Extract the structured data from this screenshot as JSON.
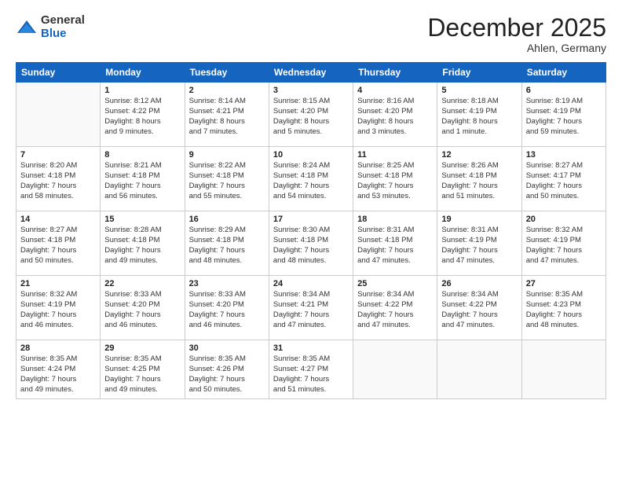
{
  "logo": {
    "general": "General",
    "blue": "Blue"
  },
  "header": {
    "month": "December 2025",
    "location": "Ahlen, Germany"
  },
  "weekdays": [
    "Sunday",
    "Monday",
    "Tuesday",
    "Wednesday",
    "Thursday",
    "Friday",
    "Saturday"
  ],
  "weeks": [
    [
      {
        "day": "",
        "info": ""
      },
      {
        "day": "1",
        "info": "Sunrise: 8:12 AM\nSunset: 4:22 PM\nDaylight: 8 hours\nand 9 minutes."
      },
      {
        "day": "2",
        "info": "Sunrise: 8:14 AM\nSunset: 4:21 PM\nDaylight: 8 hours\nand 7 minutes."
      },
      {
        "day": "3",
        "info": "Sunrise: 8:15 AM\nSunset: 4:20 PM\nDaylight: 8 hours\nand 5 minutes."
      },
      {
        "day": "4",
        "info": "Sunrise: 8:16 AM\nSunset: 4:20 PM\nDaylight: 8 hours\nand 3 minutes."
      },
      {
        "day": "5",
        "info": "Sunrise: 8:18 AM\nSunset: 4:19 PM\nDaylight: 8 hours\nand 1 minute."
      },
      {
        "day": "6",
        "info": "Sunrise: 8:19 AM\nSunset: 4:19 PM\nDaylight: 7 hours\nand 59 minutes."
      }
    ],
    [
      {
        "day": "7",
        "info": "Sunrise: 8:20 AM\nSunset: 4:18 PM\nDaylight: 7 hours\nand 58 minutes."
      },
      {
        "day": "8",
        "info": "Sunrise: 8:21 AM\nSunset: 4:18 PM\nDaylight: 7 hours\nand 56 minutes."
      },
      {
        "day": "9",
        "info": "Sunrise: 8:22 AM\nSunset: 4:18 PM\nDaylight: 7 hours\nand 55 minutes."
      },
      {
        "day": "10",
        "info": "Sunrise: 8:24 AM\nSunset: 4:18 PM\nDaylight: 7 hours\nand 54 minutes."
      },
      {
        "day": "11",
        "info": "Sunrise: 8:25 AM\nSunset: 4:18 PM\nDaylight: 7 hours\nand 53 minutes."
      },
      {
        "day": "12",
        "info": "Sunrise: 8:26 AM\nSunset: 4:18 PM\nDaylight: 7 hours\nand 51 minutes."
      },
      {
        "day": "13",
        "info": "Sunrise: 8:27 AM\nSunset: 4:17 PM\nDaylight: 7 hours\nand 50 minutes."
      }
    ],
    [
      {
        "day": "14",
        "info": "Sunrise: 8:27 AM\nSunset: 4:18 PM\nDaylight: 7 hours\nand 50 minutes."
      },
      {
        "day": "15",
        "info": "Sunrise: 8:28 AM\nSunset: 4:18 PM\nDaylight: 7 hours\nand 49 minutes."
      },
      {
        "day": "16",
        "info": "Sunrise: 8:29 AM\nSunset: 4:18 PM\nDaylight: 7 hours\nand 48 minutes."
      },
      {
        "day": "17",
        "info": "Sunrise: 8:30 AM\nSunset: 4:18 PM\nDaylight: 7 hours\nand 48 minutes."
      },
      {
        "day": "18",
        "info": "Sunrise: 8:31 AM\nSunset: 4:18 PM\nDaylight: 7 hours\nand 47 minutes."
      },
      {
        "day": "19",
        "info": "Sunrise: 8:31 AM\nSunset: 4:19 PM\nDaylight: 7 hours\nand 47 minutes."
      },
      {
        "day": "20",
        "info": "Sunrise: 8:32 AM\nSunset: 4:19 PM\nDaylight: 7 hours\nand 47 minutes."
      }
    ],
    [
      {
        "day": "21",
        "info": "Sunrise: 8:32 AM\nSunset: 4:19 PM\nDaylight: 7 hours\nand 46 minutes."
      },
      {
        "day": "22",
        "info": "Sunrise: 8:33 AM\nSunset: 4:20 PM\nDaylight: 7 hours\nand 46 minutes."
      },
      {
        "day": "23",
        "info": "Sunrise: 8:33 AM\nSunset: 4:20 PM\nDaylight: 7 hours\nand 46 minutes."
      },
      {
        "day": "24",
        "info": "Sunrise: 8:34 AM\nSunset: 4:21 PM\nDaylight: 7 hours\nand 47 minutes."
      },
      {
        "day": "25",
        "info": "Sunrise: 8:34 AM\nSunset: 4:22 PM\nDaylight: 7 hours\nand 47 minutes."
      },
      {
        "day": "26",
        "info": "Sunrise: 8:34 AM\nSunset: 4:22 PM\nDaylight: 7 hours\nand 47 minutes."
      },
      {
        "day": "27",
        "info": "Sunrise: 8:35 AM\nSunset: 4:23 PM\nDaylight: 7 hours\nand 48 minutes."
      }
    ],
    [
      {
        "day": "28",
        "info": "Sunrise: 8:35 AM\nSunset: 4:24 PM\nDaylight: 7 hours\nand 49 minutes."
      },
      {
        "day": "29",
        "info": "Sunrise: 8:35 AM\nSunset: 4:25 PM\nDaylight: 7 hours\nand 49 minutes."
      },
      {
        "day": "30",
        "info": "Sunrise: 8:35 AM\nSunset: 4:26 PM\nDaylight: 7 hours\nand 50 minutes."
      },
      {
        "day": "31",
        "info": "Sunrise: 8:35 AM\nSunset: 4:27 PM\nDaylight: 7 hours\nand 51 minutes."
      },
      {
        "day": "",
        "info": ""
      },
      {
        "day": "",
        "info": ""
      },
      {
        "day": "",
        "info": ""
      }
    ]
  ]
}
